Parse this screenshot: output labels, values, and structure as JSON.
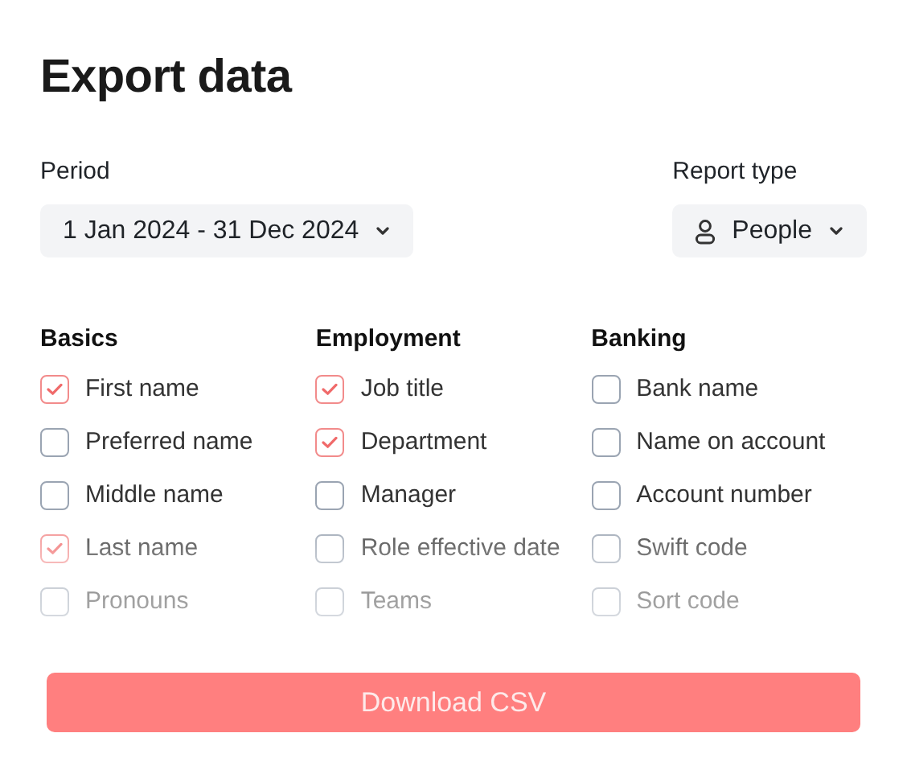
{
  "title": "Export data",
  "period": {
    "label": "Period",
    "value": "1 Jan 2024 - 31 Dec 2024"
  },
  "report_type": {
    "label": "Report type",
    "value": "People"
  },
  "columns": [
    {
      "heading": "Basics",
      "items": [
        {
          "label": "First name",
          "checked": true
        },
        {
          "label": "Preferred name",
          "checked": false
        },
        {
          "label": "Middle name",
          "checked": false
        },
        {
          "label": "Last name",
          "checked": true
        },
        {
          "label": "Pronouns",
          "checked": false
        }
      ]
    },
    {
      "heading": "Employment",
      "items": [
        {
          "label": "Job title",
          "checked": true
        },
        {
          "label": "Department",
          "checked": true
        },
        {
          "label": "Manager",
          "checked": false
        },
        {
          "label": "Role effective date",
          "checked": false
        },
        {
          "label": "Teams",
          "checked": false
        }
      ]
    },
    {
      "heading": "Banking",
      "items": [
        {
          "label": "Bank name",
          "checked": false
        },
        {
          "label": "Name on account",
          "checked": false
        },
        {
          "label": "Account number",
          "checked": false
        },
        {
          "label": "Swift code",
          "checked": false
        },
        {
          "label": "Sort code",
          "checked": false
        }
      ]
    }
  ],
  "button": "Download CSV"
}
